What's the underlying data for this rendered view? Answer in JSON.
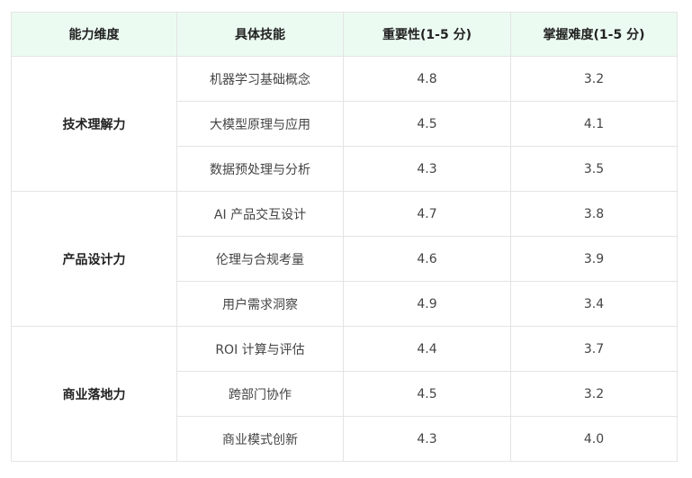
{
  "table": {
    "headers": [
      "能力维度",
      "具体技能",
      "重要性(1-5 分)",
      "掌握难度(1-5 分)"
    ],
    "groups": [
      {
        "dimension": "技术理解力",
        "rows": [
          {
            "skill": "机器学习基础概念",
            "importance": "4.8",
            "difficulty": "3.2"
          },
          {
            "skill": "大模型原理与应用",
            "importance": "4.5",
            "difficulty": "4.1"
          },
          {
            "skill": "数据预处理与分析",
            "importance": "4.3",
            "difficulty": "3.5"
          }
        ]
      },
      {
        "dimension": "产品设计力",
        "rows": [
          {
            "skill": "AI 产品交互设计",
            "importance": "4.7",
            "difficulty": "3.8"
          },
          {
            "skill": "伦理与合规考量",
            "importance": "4.6",
            "difficulty": "3.9"
          },
          {
            "skill": "用户需求洞察",
            "importance": "4.9",
            "difficulty": "3.4"
          }
        ]
      },
      {
        "dimension": "商业落地力",
        "rows": [
          {
            "skill": "ROI 计算与评估",
            "importance": "4.4",
            "difficulty": "3.7"
          },
          {
            "skill": "跨部门协作",
            "importance": "4.5",
            "difficulty": "3.2"
          },
          {
            "skill": "商业模式创新",
            "importance": "4.3",
            "difficulty": "4.0"
          }
        ]
      }
    ]
  }
}
